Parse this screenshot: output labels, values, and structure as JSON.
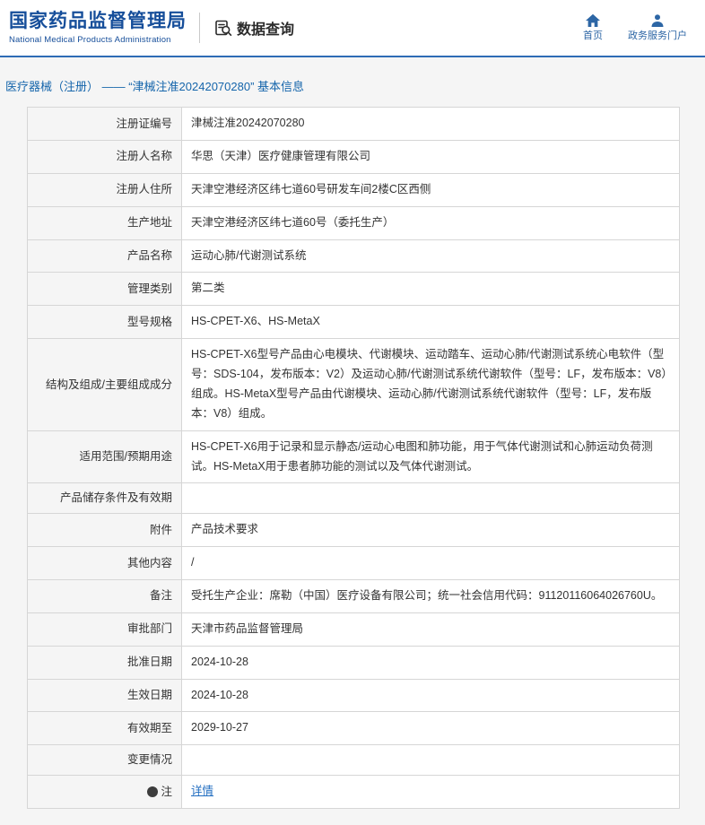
{
  "header": {
    "org_cn": "国家药品监督管理局",
    "org_en": "National Medical Products Administration",
    "nav_title": "数据查询",
    "links": [
      {
        "label": "首页",
        "icon": "home-icon"
      },
      {
        "label": "政务服务门户",
        "icon": "user-icon"
      }
    ]
  },
  "icons": {
    "data_query": "document-with-magnifier",
    "home": "house",
    "portal": "person",
    "note": "filled-circle"
  },
  "colors": {
    "brand_blue": "#164e9a",
    "link_blue": "#1f6cc0",
    "rule_blue": "#2e6cb5",
    "page_gray": "#f5f5f5",
    "border_gray": "#d6d6d6"
  },
  "breadcrumb": {
    "text": "医疗器械（注册） —— “津械注准20242070280” 基本信息"
  },
  "table": {
    "rows": [
      {
        "label": "注册证编号",
        "value": "津械注准20242070280"
      },
      {
        "label": "注册人名称",
        "value": "华思（天津）医疗健康管理有限公司"
      },
      {
        "label": "注册人住所",
        "value": "天津空港经济区纬七道60号研发车间2楼C区西侧"
      },
      {
        "label": "生产地址",
        "value": "天津空港经济区纬七道60号（委托生产）"
      },
      {
        "label": "产品名称",
        "value": "运动心肺/代谢测试系统"
      },
      {
        "label": "管理类别",
        "value": "第二类"
      },
      {
        "label": "型号规格",
        "value": "HS-CPET-X6、HS-MetaX"
      },
      {
        "label": "结构及组成/主要组成成分",
        "value": "HS-CPET-X6型号产品由心电模块、代谢模块、运动踏车、运动心肺/代谢测试系统心电软件（型号：SDS-104，发布版本：V2）及运动心肺/代谢测试系统代谢软件（型号：LF，发布版本：V8）组成。HS-MetaX型号产品由代谢模块、运动心肺/代谢测试系统代谢软件（型号：LF，发布版本：V8）组成。"
      },
      {
        "label": "适用范围/预期用途",
        "value": "HS-CPET-X6用于记录和显示静态/运动心电图和肺功能，用于气体代谢测试和心肺运动负荷测试。HS-MetaX用于患者肺功能的测试以及气体代谢测试。"
      },
      {
        "label": "产品储存条件及有效期",
        "value": ""
      },
      {
        "label": "附件",
        "value": "产品技术要求"
      },
      {
        "label": "其他内容",
        "value": "/"
      },
      {
        "label": "备注",
        "value": "受托生产企业：席勒（中国）医疗设备有限公司；统一社会信用代码：91120116064026760U。"
      },
      {
        "label": "审批部门",
        "value": "天津市药品监督管理局"
      },
      {
        "label": "批准日期",
        "value": "2024-10-28"
      },
      {
        "label": "生效日期",
        "value": "2024-10-28"
      },
      {
        "label": "有效期至",
        "value": "2029-10-27"
      },
      {
        "label": "变更情况",
        "value": ""
      },
      {
        "label": "注",
        "icon": true,
        "link": true,
        "value": "详情"
      }
    ]
  }
}
